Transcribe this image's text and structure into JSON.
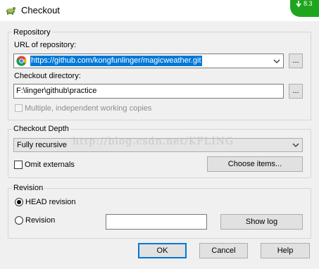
{
  "window": {
    "title": "Checkout",
    "badge": "8.3",
    "colors": {
      "accent": "#0078d7",
      "badge": "#1ea51e"
    }
  },
  "repository": {
    "legend": "Repository",
    "url_label": "URL of repository:",
    "url_value": "https://github.com/kongfunlinger/magicweather.git",
    "dir_label": "Checkout directory:",
    "dir_value": "F:\\linger\\github\\practice",
    "browse_label": "...",
    "multiple_label": "Multiple, independent working copies"
  },
  "depth": {
    "legend": "Checkout Depth",
    "selected": "Fully recursive",
    "omit_label": "Omit externals",
    "choose_items": "Choose items..."
  },
  "watermark": "http://blog.csdn.net/KFLING",
  "revision": {
    "legend": "Revision",
    "head_label": "HEAD revision",
    "rev_label": "Revision",
    "rev_value": "",
    "show_log": "Show log"
  },
  "buttons": {
    "ok": "OK",
    "cancel": "Cancel",
    "help": "Help"
  }
}
